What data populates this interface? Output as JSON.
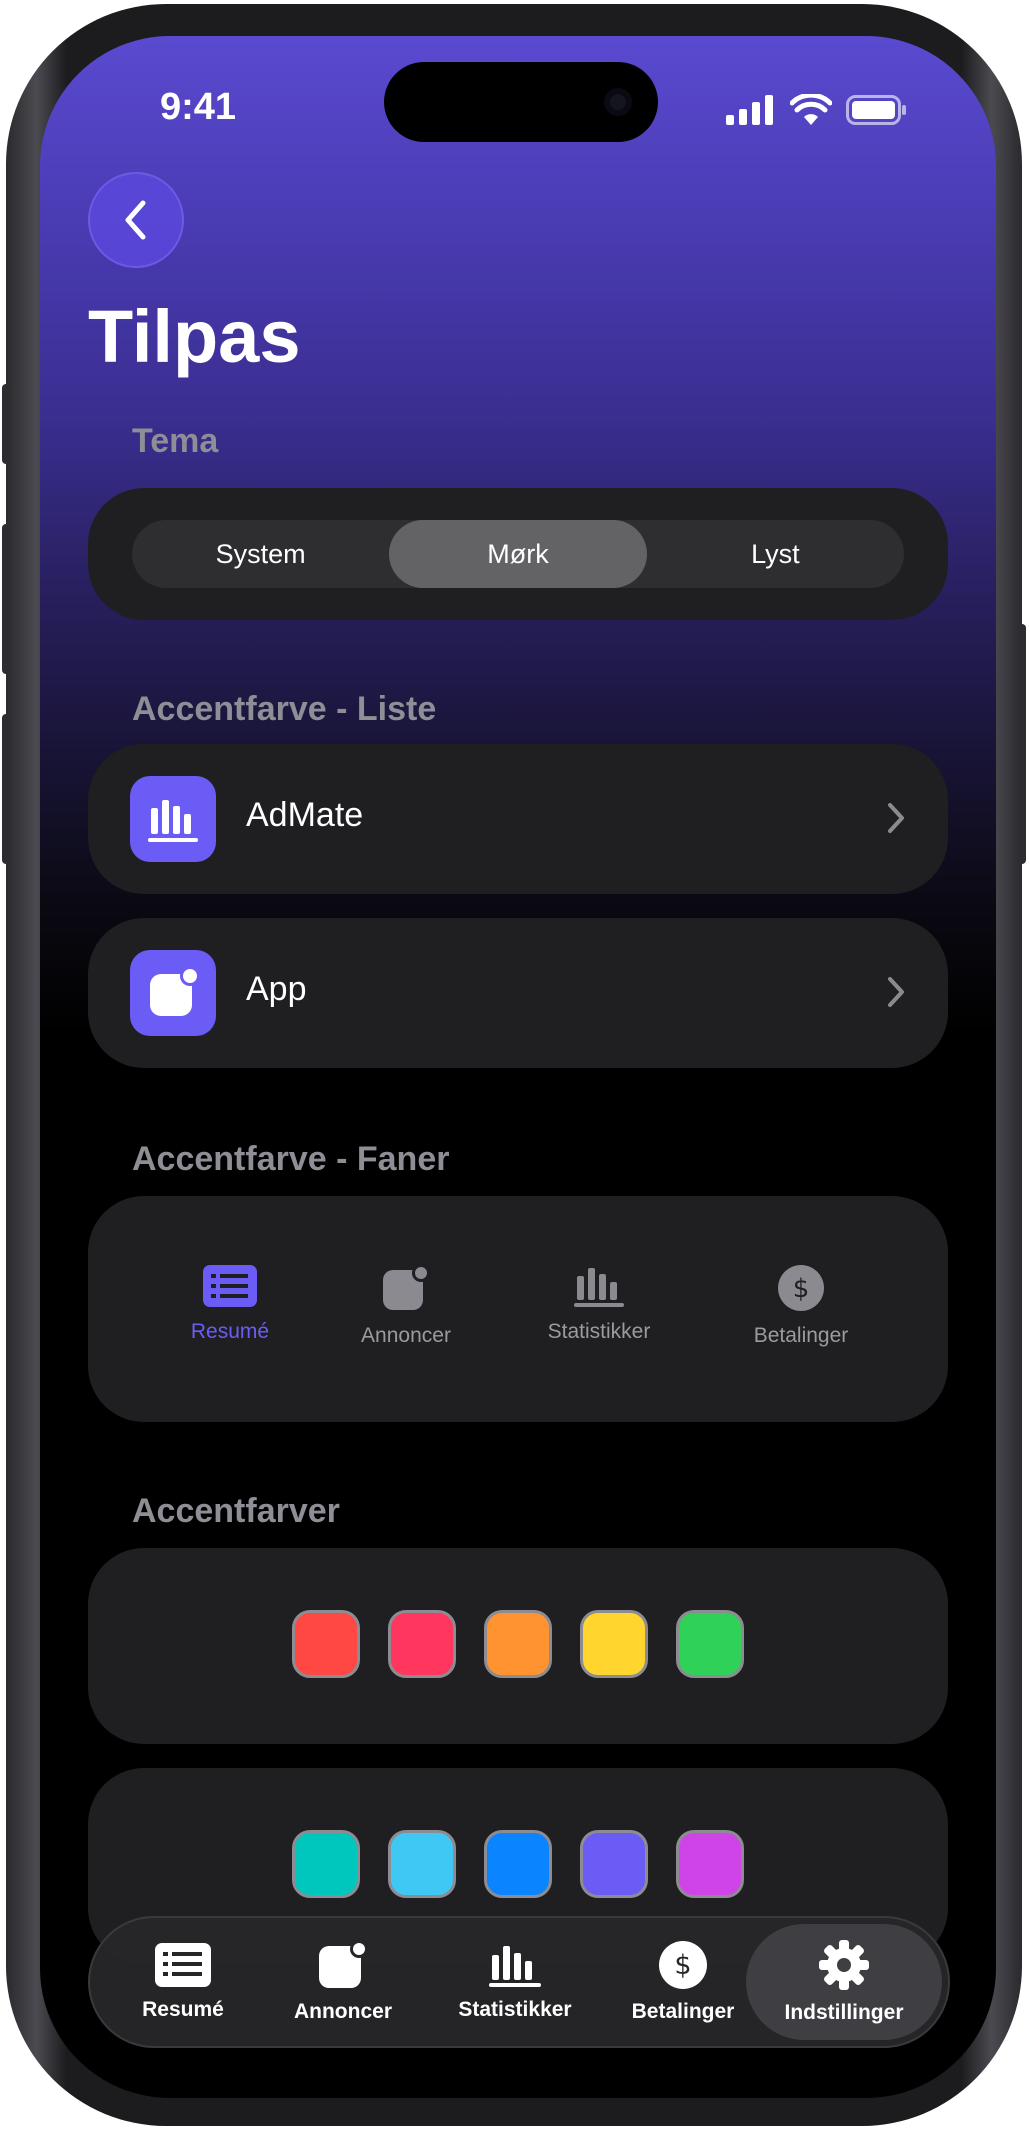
{
  "status_bar": {
    "time": "9:41"
  },
  "page": {
    "title": "Tilpas"
  },
  "theme": {
    "section_label": "Tema",
    "options": [
      "System",
      "Mørk",
      "Lyst"
    ],
    "selected": "Mørk"
  },
  "accent_list": {
    "section_label": "Accentfarve - Liste",
    "items": [
      {
        "label": "AdMate",
        "icon": "bar-chart-icon"
      },
      {
        "label": "App",
        "icon": "app-badge-icon"
      }
    ]
  },
  "accent_tabs": {
    "section_label": "Accentfarve - Faner",
    "items": [
      {
        "label": "Resumé",
        "icon": "list-icon",
        "selected": true
      },
      {
        "label": "Annoncer",
        "icon": "app-badge-icon"
      },
      {
        "label": "Statistikker",
        "icon": "bar-chart-icon"
      },
      {
        "label": "Betalinger",
        "icon": "dollar-icon"
      }
    ]
  },
  "accent_colors": {
    "section_label": "Accentfarver",
    "rows": [
      [
        "#ff4744",
        "#ff375f",
        "#ff9330",
        "#ffd52e",
        "#30d158"
      ],
      [
        "#00c7be",
        "#40c8f4",
        "#0a84ff",
        "#6b5cf6",
        "#cf44e6"
      ]
    ]
  },
  "tab_bar": {
    "items": [
      {
        "label": "Resumé",
        "icon": "list-icon"
      },
      {
        "label": "Annoncer",
        "icon": "app-badge-icon"
      },
      {
        "label": "Statistikker",
        "icon": "bar-chart-icon"
      },
      {
        "label": "Betalinger",
        "icon": "dollar-icon"
      },
      {
        "label": "Indstillinger",
        "icon": "gear-icon",
        "active": true
      }
    ]
  },
  "colors": {
    "accent": "#6b5cf6",
    "card": "#1f1f21",
    "section_text": "#8e8e96"
  }
}
